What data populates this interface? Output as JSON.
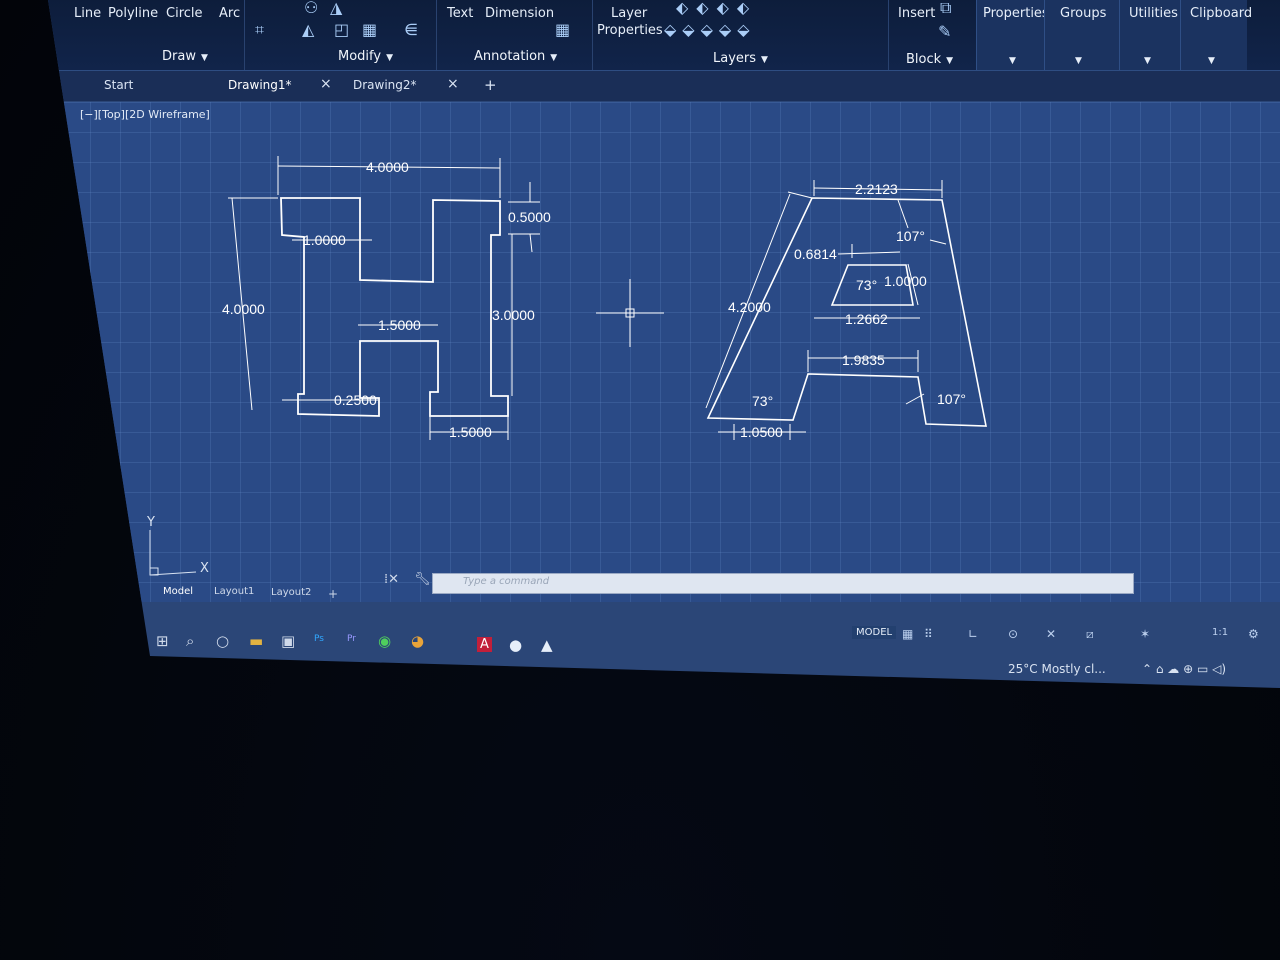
{
  "ribbon": {
    "draw": {
      "line": "Line",
      "polyline": "Polyline",
      "circle": "Circle",
      "arc": "Arc",
      "panel": "Draw"
    },
    "modify": {
      "panel": "Modify"
    },
    "annotation": {
      "text": "Text",
      "dimension": "Dimension",
      "panel": "Annotation"
    },
    "layers": {
      "layer_properties_line1": "Layer",
      "layer_properties_line2": "Properties",
      "panel": "Layers"
    },
    "block": {
      "insert": "Insert",
      "panel": "Block"
    },
    "properties": "Properties",
    "groups": "Groups",
    "utilities": "Utilities",
    "clipboard": "Clipboard"
  },
  "tabs": {
    "start": "Start",
    "drawing1": "Drawing1*",
    "drawing2": "Drawing2*",
    "close": "×",
    "new": "+"
  },
  "viewport": {
    "controls": "[−][Top][2D Wireframe]"
  },
  "ucs": {
    "y": "Y",
    "x": "X"
  },
  "dimensions": {
    "h_width": "4.0000",
    "h_top_gap": "0.5000",
    "h_stem": "1.0000",
    "h_height": "4.0000",
    "h_bar_len": "1.5000",
    "h_inner": "3.0000",
    "h_foot": "0.2500",
    "h_bottom": "1.5000",
    "a_top": "2.2123",
    "a_angle_top": "107°",
    "a_side_small": "0.6814",
    "a_angle_inner": "73°",
    "a_inner_height": "1.0000",
    "a_side": "4.2000",
    "a_inner_width": "1.2662",
    "a_cross": "1.9835",
    "a_angle_bl": "73°",
    "a_angle_br": "107°",
    "a_foot": "1.0500"
  },
  "layout_tabs": {
    "model": "Model",
    "layout1": "Layout1",
    "layout2": "Layout2",
    "add": "+"
  },
  "command_line": {
    "placeholder": "Type a command"
  },
  "status_bar": {
    "model": "MODEL",
    "scale": "1:1"
  },
  "tray": {
    "weather": "25°C  Mostly cl..."
  }
}
